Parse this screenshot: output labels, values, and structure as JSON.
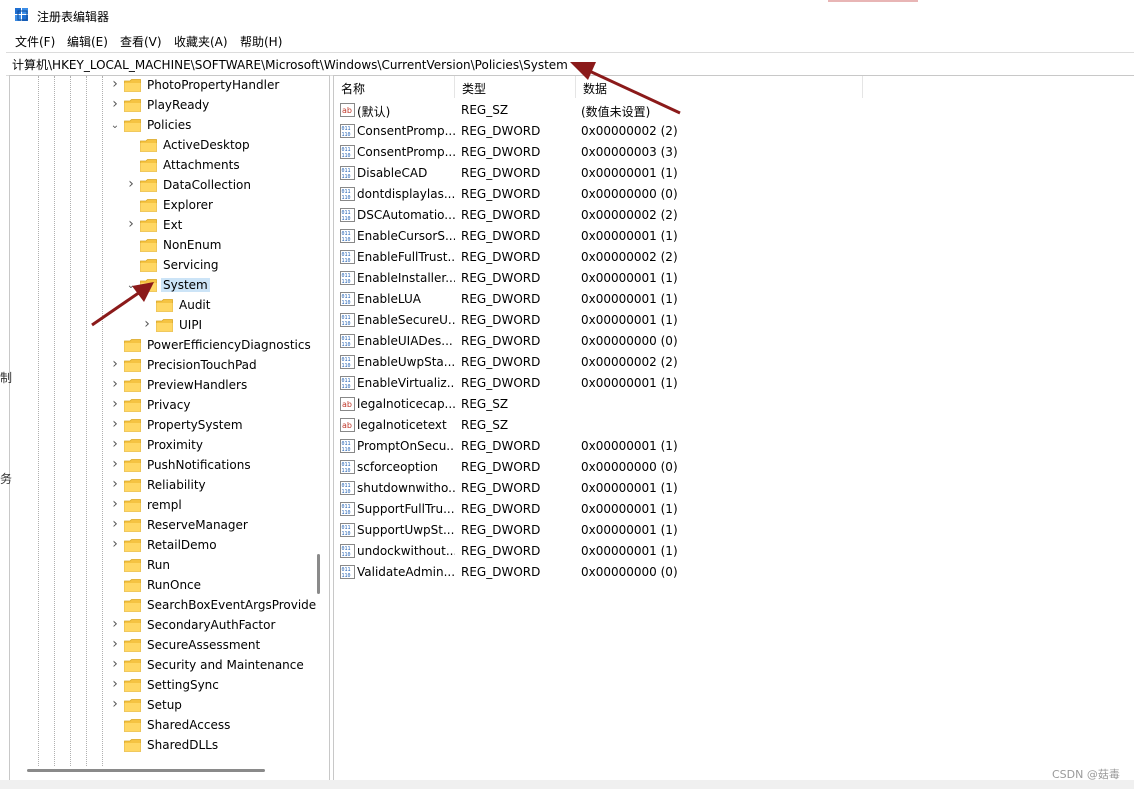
{
  "window": {
    "title": "注册表编辑器"
  },
  "menu": [
    "文件(F)",
    "编辑(E)",
    "查看(V)",
    "收藏夹(A)",
    "帮助(H)"
  ],
  "address": "计算机\\HKEY_LOCAL_MACHINE\\SOFTWARE\\Microsoft\\Windows\\CurrentVersion\\Policies\\System",
  "tree": [
    {
      "label": "PhotoPropertyHandler",
      "expander": "collapsed",
      "level": 0
    },
    {
      "label": "PlayReady",
      "expander": "collapsed",
      "level": 0
    },
    {
      "label": "Policies",
      "expander": "expanded",
      "level": 0
    },
    {
      "label": "ActiveDesktop",
      "expander": "none",
      "level": 1
    },
    {
      "label": "Attachments",
      "expander": "none",
      "level": 1
    },
    {
      "label": "DataCollection",
      "expander": "collapsed",
      "level": 1
    },
    {
      "label": "Explorer",
      "expander": "none",
      "level": 1
    },
    {
      "label": "Ext",
      "expander": "collapsed",
      "level": 1
    },
    {
      "label": "NonEnum",
      "expander": "none",
      "level": 1
    },
    {
      "label": "Servicing",
      "expander": "none",
      "level": 1
    },
    {
      "label": "System",
      "expander": "expanded",
      "level": 1,
      "selected": true
    },
    {
      "label": "Audit",
      "expander": "none",
      "level": 2
    },
    {
      "label": "UIPI",
      "expander": "collapsed",
      "level": 2
    },
    {
      "label": "PowerEfficiencyDiagnostics",
      "expander": "none",
      "level": 0
    },
    {
      "label": "PrecisionTouchPad",
      "expander": "collapsed",
      "level": 0
    },
    {
      "label": "PreviewHandlers",
      "expander": "collapsed",
      "level": 0
    },
    {
      "label": "Privacy",
      "expander": "collapsed",
      "level": 0
    },
    {
      "label": "PropertySystem",
      "expander": "collapsed",
      "level": 0
    },
    {
      "label": "Proximity",
      "expander": "collapsed",
      "level": 0
    },
    {
      "label": "PushNotifications",
      "expander": "collapsed",
      "level": 0
    },
    {
      "label": "Reliability",
      "expander": "collapsed",
      "level": 0
    },
    {
      "label": "rempl",
      "expander": "collapsed",
      "level": 0
    },
    {
      "label": "ReserveManager",
      "expander": "collapsed",
      "level": 0
    },
    {
      "label": "RetailDemo",
      "expander": "collapsed",
      "level": 0
    },
    {
      "label": "Run",
      "expander": "none",
      "level": 0
    },
    {
      "label": "RunOnce",
      "expander": "none",
      "level": 0
    },
    {
      "label": "SearchBoxEventArgsProvide",
      "expander": "none",
      "level": 0
    },
    {
      "label": "SecondaryAuthFactor",
      "expander": "collapsed",
      "level": 0
    },
    {
      "label": "SecureAssessment",
      "expander": "collapsed",
      "level": 0
    },
    {
      "label": "Security and Maintenance",
      "expander": "collapsed",
      "level": 0
    },
    {
      "label": "SettingSync",
      "expander": "collapsed",
      "level": 0
    },
    {
      "label": "Setup",
      "expander": "collapsed",
      "level": 0
    },
    {
      "label": "SharedAccess",
      "expander": "none",
      "level": 0
    },
    {
      "label": "SharedDLLs",
      "expander": "none",
      "level": 0
    }
  ],
  "columns": [
    "名称",
    "类型",
    "数据"
  ],
  "values": [
    {
      "icon": "string-value-icon",
      "name": "(默认)",
      "type": "REG_SZ",
      "data": "(数值未设置)"
    },
    {
      "icon": "binary-value-icon",
      "name": "ConsentPromp...",
      "type": "REG_DWORD",
      "data": "0x00000002 (2)"
    },
    {
      "icon": "binary-value-icon",
      "name": "ConsentPromp...",
      "type": "REG_DWORD",
      "data": "0x00000003 (3)"
    },
    {
      "icon": "binary-value-icon",
      "name": "DisableCAD",
      "type": "REG_DWORD",
      "data": "0x00000001 (1)"
    },
    {
      "icon": "binary-value-icon",
      "name": "dontdisplaylas...",
      "type": "REG_DWORD",
      "data": "0x00000000 (0)"
    },
    {
      "icon": "binary-value-icon",
      "name": "DSCAutomatio...",
      "type": "REG_DWORD",
      "data": "0x00000002 (2)"
    },
    {
      "icon": "binary-value-icon",
      "name": "EnableCursorS...",
      "type": "REG_DWORD",
      "data": "0x00000001 (1)"
    },
    {
      "icon": "binary-value-icon",
      "name": "EnableFullTrust...",
      "type": "REG_DWORD",
      "data": "0x00000002 (2)"
    },
    {
      "icon": "binary-value-icon",
      "name": "EnableInstaller...",
      "type": "REG_DWORD",
      "data": "0x00000001 (1)"
    },
    {
      "icon": "binary-value-icon",
      "name": "EnableLUA",
      "type": "REG_DWORD",
      "data": "0x00000001 (1)"
    },
    {
      "icon": "binary-value-icon",
      "name": "EnableSecureU...",
      "type": "REG_DWORD",
      "data": "0x00000001 (1)"
    },
    {
      "icon": "binary-value-icon",
      "name": "EnableUIADes...",
      "type": "REG_DWORD",
      "data": "0x00000000 (0)"
    },
    {
      "icon": "binary-value-icon",
      "name": "EnableUwpSta...",
      "type": "REG_DWORD",
      "data": "0x00000002 (2)"
    },
    {
      "icon": "binary-value-icon",
      "name": "EnableVirtualiz...",
      "type": "REG_DWORD",
      "data": "0x00000001 (1)"
    },
    {
      "icon": "string-value-icon",
      "name": "legalnoticecap...",
      "type": "REG_SZ",
      "data": ""
    },
    {
      "icon": "string-value-icon",
      "name": "legalnoticetext",
      "type": "REG_SZ",
      "data": ""
    },
    {
      "icon": "binary-value-icon",
      "name": "PromptOnSecu...",
      "type": "REG_DWORD",
      "data": "0x00000001 (1)"
    },
    {
      "icon": "binary-value-icon",
      "name": "scforceoption",
      "type": "REG_DWORD",
      "data": "0x00000000 (0)"
    },
    {
      "icon": "binary-value-icon",
      "name": "shutdownwitho...",
      "type": "REG_DWORD",
      "data": "0x00000001 (1)"
    },
    {
      "icon": "binary-value-icon",
      "name": "SupportFullTru...",
      "type": "REG_DWORD",
      "data": "0x00000001 (1)"
    },
    {
      "icon": "binary-value-icon",
      "name": "SupportUwpSt...",
      "type": "REG_DWORD",
      "data": "0x00000001 (1)"
    },
    {
      "icon": "binary-value-icon",
      "name": "undockwithout...",
      "type": "REG_DWORD",
      "data": "0x00000001 (1)"
    },
    {
      "icon": "binary-value-icon",
      "name": "ValidateAdmin...",
      "type": "REG_DWORD",
      "data": "0x00000000 (0)"
    }
  ],
  "side_fragments": [
    "制",
    "务"
  ],
  "watermark": "CSDN @菇毒",
  "colors": {
    "annotation_arrow": "#8b1a1a",
    "selection": "#cce4f7",
    "folder": "#f5c342"
  }
}
